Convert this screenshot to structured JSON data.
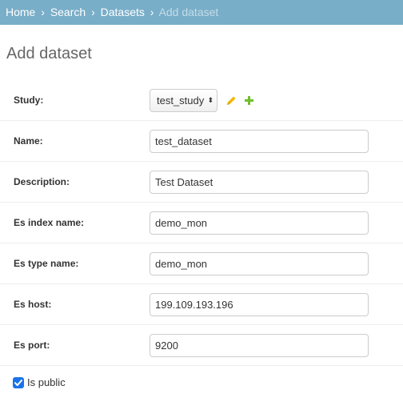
{
  "breadcrumbs": {
    "home": "Home",
    "search": "Search",
    "datasets": "Datasets",
    "current": "Add dataset",
    "separator": "›"
  },
  "page_title": "Add dataset",
  "fields": {
    "study": {
      "label": "Study:",
      "value": "test_study"
    },
    "name": {
      "label": "Name:",
      "value": "test_dataset"
    },
    "description": {
      "label": "Description:",
      "value": "Test Dataset"
    },
    "es_index_name": {
      "label": "Es index name:",
      "value": "demo_mon"
    },
    "es_type_name": {
      "label": "Es type name:",
      "value": "demo_mon"
    },
    "es_host": {
      "label": "Es host:",
      "value": "199.109.193.196"
    },
    "es_port": {
      "label": "Es port:",
      "value": "9200"
    },
    "is_public": {
      "label": "Is public",
      "checked": true
    }
  },
  "colors": {
    "breadcrumb_bg": "#79aec8",
    "edit_icon": "#efb80b",
    "add_icon": "#70bf2b",
    "checkbox": "#1a73e8"
  },
  "icons": {
    "edit": "pencil-icon",
    "add": "plus-icon",
    "select_arrows": "up-down-arrows-icon",
    "checkmark": "checkmark-icon"
  }
}
